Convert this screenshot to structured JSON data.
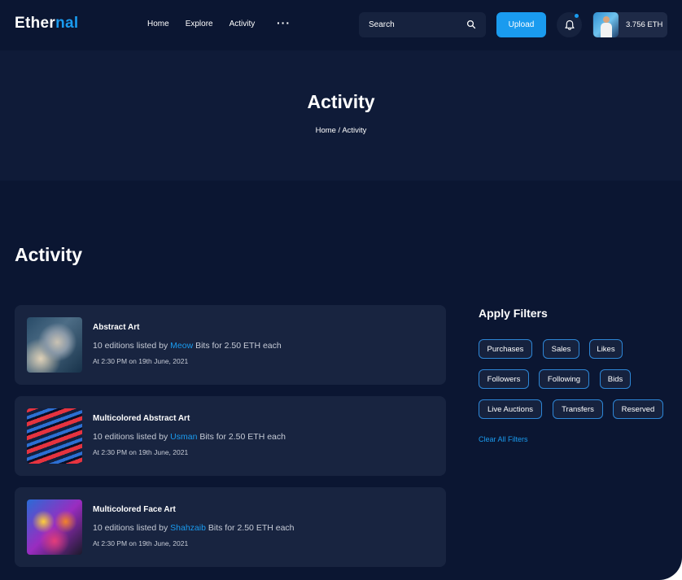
{
  "header": {
    "logo_main": "Ether",
    "logo_accent": "nal",
    "nav": [
      "Home",
      "Explore",
      "Activity"
    ],
    "more": "···",
    "search_placeholder": "Search",
    "upload_label": "Upload",
    "balance": "3.756 ETH",
    "accent_color": "#1a9bef"
  },
  "banner": {
    "title": "Activity",
    "breadcrumb": "Home / Activity"
  },
  "section_title": "Activity",
  "activities": [
    {
      "title": "Abstract Art",
      "prefix": "10 editions listed by ",
      "user": "Meow",
      "suffix": " Bits for 2.50 ETH each",
      "time": "At 2:30 PM on 19th June, 2021"
    },
    {
      "title": "Multicolored Abstract Art",
      "prefix": "10 editions listed by ",
      "user": "Usman",
      "suffix": " Bits for 2.50 ETH each",
      "time": "At 2:30 PM on 19th June, 2021"
    },
    {
      "title": "Multicolored Face Art",
      "prefix": "10 editions listed by ",
      "user": "Shahzaib",
      "suffix": " Bits for 2.50 ETH each",
      "time": "At 2:30 PM on 19th June, 2021"
    }
  ],
  "filters": {
    "title": "Apply Filters",
    "chips": [
      "Purchases",
      "Sales",
      "Likes",
      "Followers",
      "Following",
      "Bids",
      "Live Auctions",
      "Transfers",
      "Reserved"
    ],
    "clear_label": "Clear All Filters"
  }
}
